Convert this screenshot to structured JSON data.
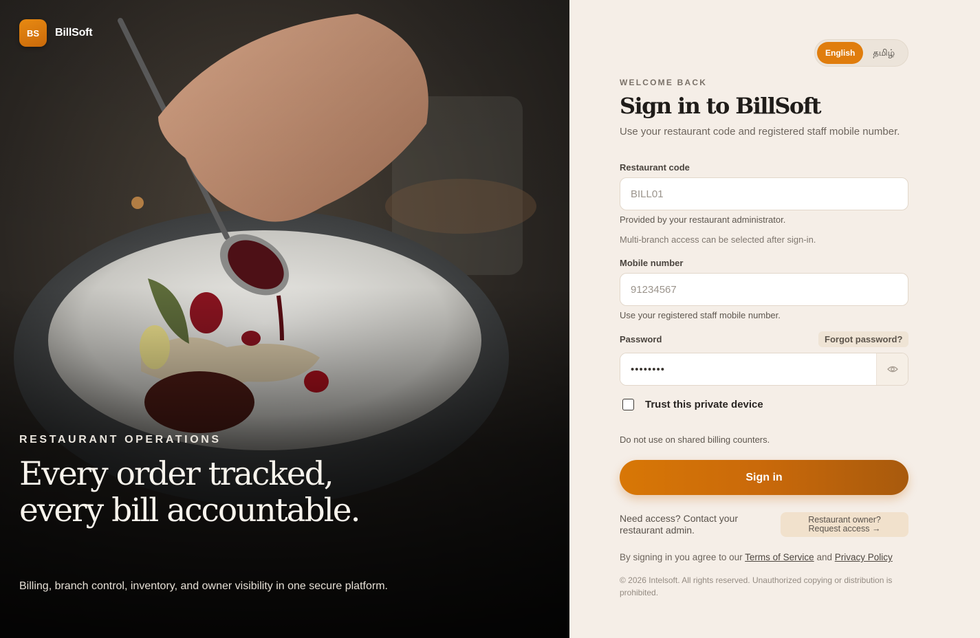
{
  "brand": {
    "badge": "BS",
    "name": "BillSoft"
  },
  "hero": {
    "eyebrow": "RESTAURANT OPERATIONS",
    "title": "Every order tracked, every bill accountable.",
    "subtitle": "Billing, branch control, inventory, and owner visibility in one secure platform."
  },
  "language": {
    "english": "English",
    "tamil": "தமிழ்",
    "selected": "English"
  },
  "form": {
    "eyebrow": "WELCOME BACK",
    "title": "Sign in to BillSoft",
    "subtitle": "Use your restaurant code and registered staff mobile number.",
    "restaurant_code": {
      "label": "Restaurant code",
      "placeholder": "BILL01",
      "hint": "Provided by your restaurant administrator.",
      "hint2": "Multi-branch access can be selected after sign-in."
    },
    "mobile": {
      "label": "Mobile number",
      "placeholder": "91234567",
      "hint": "Use your registered staff mobile number."
    },
    "password": {
      "label": "Password",
      "value": "••••••••",
      "forgot": "Forgot password?",
      "toggle_icon": "eye-icon"
    },
    "trust": {
      "label": "Trust this private device",
      "checked": false,
      "hint": "Do not use on shared billing counters."
    },
    "submit": "Sign in",
    "need_access": "Need access? Contact your restaurant admin.",
    "owner_request": {
      "line1": "Restaurant owner?",
      "line2": "Request access →"
    },
    "legal": {
      "prefix": "By signing in you agree to our",
      "terms": "Terms of Service",
      "and": "and",
      "privacy": "Privacy Policy"
    },
    "copyright": "© 2026 Intelsoft. All rights reserved. Unauthorized copying or distribution is prohibited."
  },
  "colors": {
    "accent": "#e07d0d",
    "panel_bg": "#f5eee7"
  }
}
